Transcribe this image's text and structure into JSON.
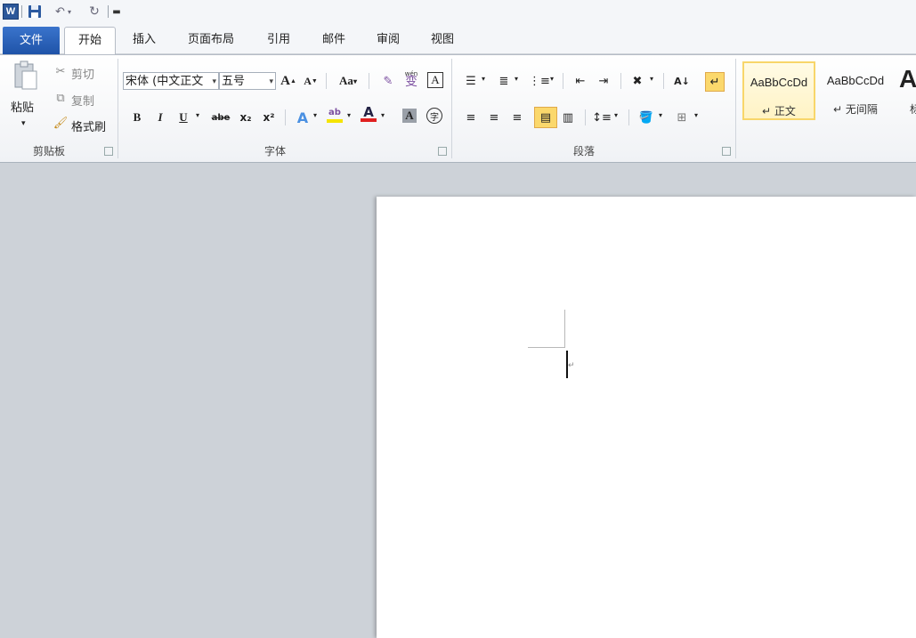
{
  "window": {
    "logo_letter": "W"
  },
  "qat": {
    "save_icon": "save-icon",
    "undo_icon": "undo-icon",
    "redo_icon": "redo-icon"
  },
  "tabs": [
    {
      "label": "文件"
    },
    {
      "label": "开始"
    },
    {
      "label": "插入"
    },
    {
      "label": "页面布局"
    },
    {
      "label": "引用"
    },
    {
      "label": "邮件"
    },
    {
      "label": "审阅"
    },
    {
      "label": "视图"
    }
  ],
  "clipboard": {
    "paste_label": "粘贴",
    "cut_label": "剪切",
    "copy_label": "复制",
    "format_painter_label": "格式刷",
    "group_label": "剪贴板"
  },
  "font": {
    "font_name": "宋体 (中文正文",
    "font_size": "五号",
    "group_label": "字体",
    "aa_label": "Aa",
    "bold": "B",
    "italic": "I",
    "underline": "U",
    "strike": "abe",
    "sub": "x₂",
    "sup": "x²",
    "grow": "A",
    "shrink": "A",
    "wen": "wén",
    "wen_char": "变",
    "boxed_a": "A",
    "font_color_a": "A",
    "shade_a": "A",
    "enclose_char": "字",
    "highlight_ab": "ab"
  },
  "paragraph": {
    "group_label": "段落"
  },
  "styles": {
    "items": [
      {
        "sample": "AaBbCcDd",
        "name": "正文"
      },
      {
        "sample": "AaBbCcDd",
        "name": "无间隔"
      },
      {
        "sample": "A",
        "name": "标"
      }
    ]
  },
  "colors": {
    "file_tab": "#2b579a",
    "font_color": "#e02020",
    "highlight": "#f5e400",
    "selected_style": "#f8d66a"
  }
}
